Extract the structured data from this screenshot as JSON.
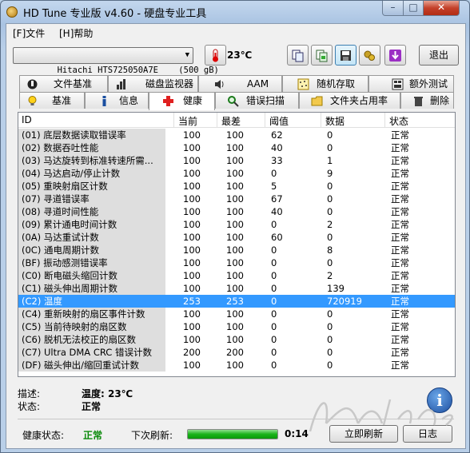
{
  "window": {
    "title": "HD Tune 专业版 v4.60 - 硬盘专业工具",
    "min": "–",
    "max": "□",
    "close": "✕"
  },
  "menu": {
    "file": "[F]文件",
    "help": "[H]帮助"
  },
  "toolbar": {
    "drive": "Hitachi HTS725050A7E    (500 gB)",
    "temperature": "23℃",
    "exit_label": "退出"
  },
  "tabs_top": [
    "文件基准",
    "磁盘监视器",
    "AAM",
    "随机存取",
    "额外测试"
  ],
  "tabs_bottom": [
    "基准",
    "信息",
    "健康",
    "错误扫描",
    "文件夹占用率",
    "删除"
  ],
  "active_tab": "健康",
  "table": {
    "headers": [
      "ID",
      "当前",
      "最差",
      "阈值",
      "数据",
      "状态"
    ],
    "rows": [
      {
        "id": "(01) 底层数据读取错误率",
        "current": "100",
        "worst": "100",
        "threshold": "62",
        "data": "0",
        "status": "正常"
      },
      {
        "id": "(02) 数据吞吐性能",
        "current": "100",
        "worst": "100",
        "threshold": "40",
        "data": "0",
        "status": "正常"
      },
      {
        "id": "(03) 马达旋转到标准转速所需...",
        "current": "100",
        "worst": "100",
        "threshold": "33",
        "data": "1",
        "status": "正常"
      },
      {
        "id": "(04) 马达启动/停止计数",
        "current": "100",
        "worst": "100",
        "threshold": "0",
        "data": "9",
        "status": "正常"
      },
      {
        "id": "(05) 重映射扇区计数",
        "current": "100",
        "worst": "100",
        "threshold": "5",
        "data": "0",
        "status": "正常"
      },
      {
        "id": "(07) 寻道错误率",
        "current": "100",
        "worst": "100",
        "threshold": "67",
        "data": "0",
        "status": "正常"
      },
      {
        "id": "(08) 寻道时间性能",
        "current": "100",
        "worst": "100",
        "threshold": "40",
        "data": "0",
        "status": "正常"
      },
      {
        "id": "(09) 累计通电时间计数",
        "current": "100",
        "worst": "100",
        "threshold": "0",
        "data": "2",
        "status": "正常"
      },
      {
        "id": "(0A) 马达重试计数",
        "current": "100",
        "worst": "100",
        "threshold": "60",
        "data": "0",
        "status": "正常"
      },
      {
        "id": "(0C) 通电周期计数",
        "current": "100",
        "worst": "100",
        "threshold": "0",
        "data": "8",
        "status": "正常"
      },
      {
        "id": "(BF) 振动感测错误率",
        "current": "100",
        "worst": "100",
        "threshold": "0",
        "data": "0",
        "status": "正常"
      },
      {
        "id": "(C0) 断电磁头缩回计数",
        "current": "100",
        "worst": "100",
        "threshold": "0",
        "data": "2",
        "status": "正常"
      },
      {
        "id": "(C1) 磁头伸出周期计数",
        "current": "100",
        "worst": "100",
        "threshold": "0",
        "data": "139",
        "status": "正常"
      },
      {
        "id": "(C2) 温度",
        "current": "253",
        "worst": "253",
        "threshold": "0",
        "data": "720919",
        "status": "正常"
      },
      {
        "id": "(C4) 重新映射的扇区事件计数",
        "current": "100",
        "worst": "100",
        "threshold": "0",
        "data": "0",
        "status": "正常"
      },
      {
        "id": "(C5) 当前待映射的扇区数",
        "current": "100",
        "worst": "100",
        "threshold": "0",
        "data": "0",
        "status": "正常"
      },
      {
        "id": "(C6) 脱机无法校正的扇区数",
        "current": "100",
        "worst": "100",
        "threshold": "0",
        "data": "0",
        "status": "正常"
      },
      {
        "id": "(C7) Ultra DMA CRC 错误计数",
        "current": "200",
        "worst": "200",
        "threshold": "0",
        "data": "0",
        "status": "正常"
      },
      {
        "id": "(DF) 磁头伸出/缩回重试计数",
        "current": "100",
        "worst": "100",
        "threshold": "0",
        "data": "0",
        "status": "正常"
      }
    ],
    "selected_row": 13
  },
  "details": {
    "desc_label": "描述:",
    "desc_value": "温度: 23℃",
    "status_label": "状态:",
    "status_value": "正常"
  },
  "footer": {
    "health_label": "健康状态:",
    "health_value": "正常",
    "refresh_label": "下次刷新:",
    "refresh_progress": 1.0,
    "countdown": "0:14",
    "refresh_now": "立即刷新",
    "log": "日志"
  },
  "watermark": "鸿利在线"
}
